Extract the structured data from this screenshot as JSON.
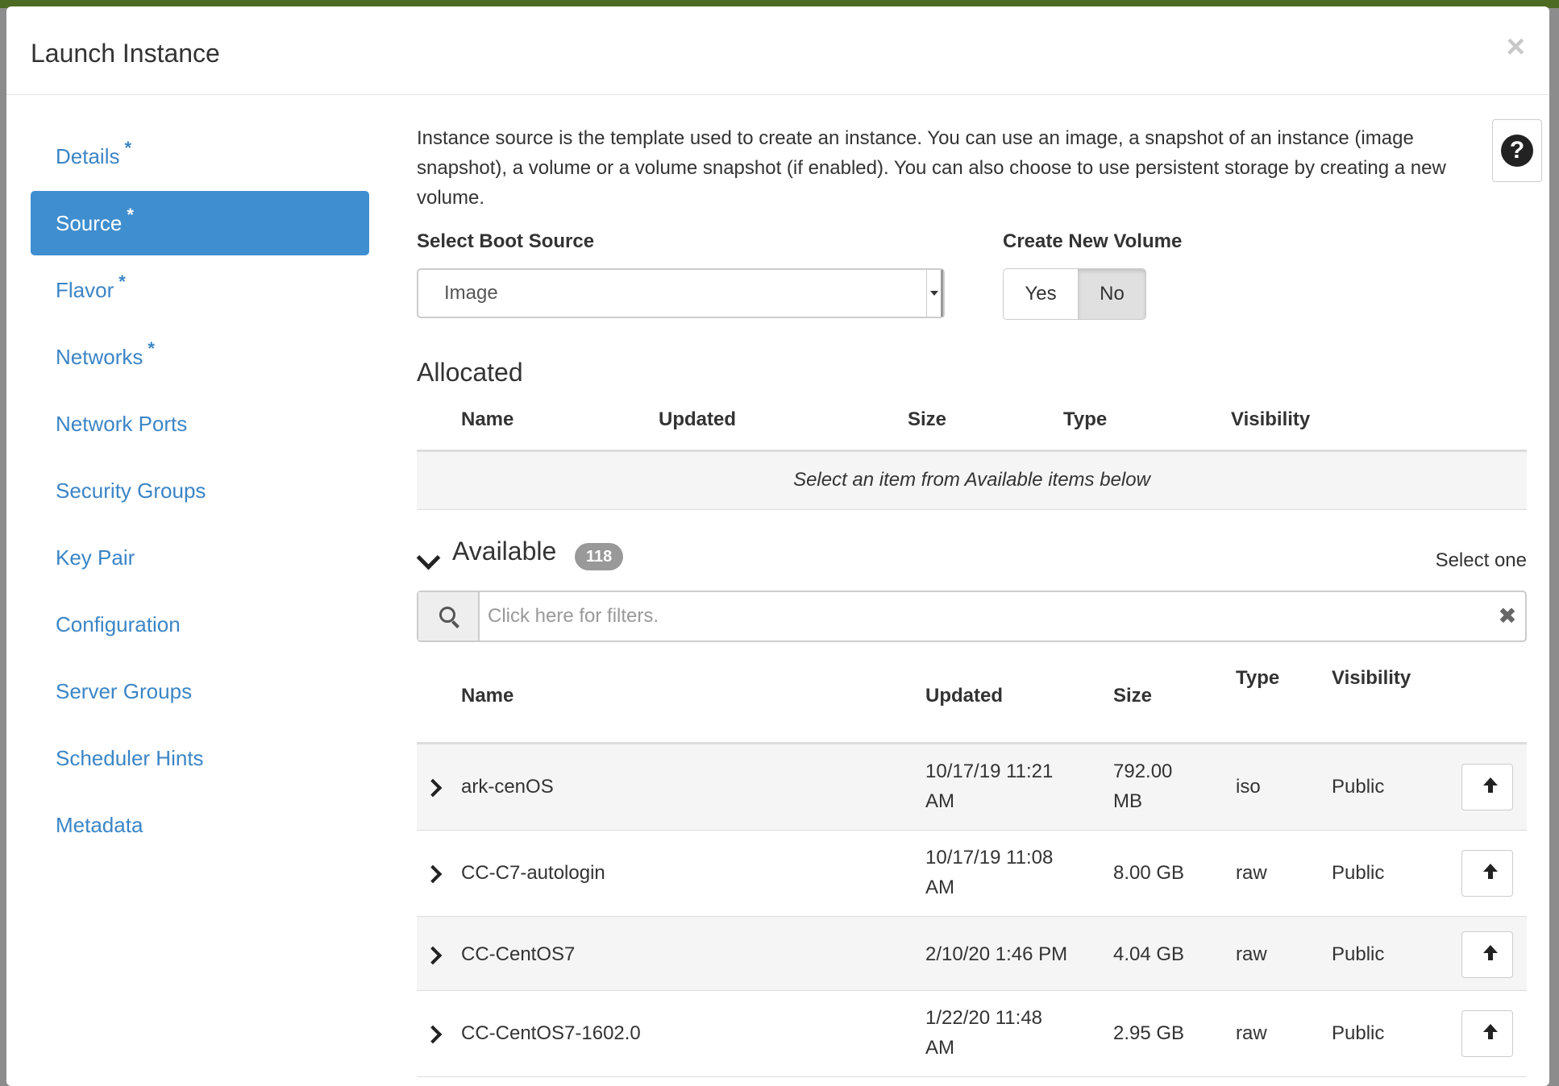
{
  "modal": {
    "title": "Launch Instance",
    "close": "×"
  },
  "sidebar": {
    "items": [
      {
        "label": "Details",
        "required": "*"
      },
      {
        "label": "Source",
        "required": "*",
        "active": true
      },
      {
        "label": "Flavor",
        "required": "*"
      },
      {
        "label": "Networks",
        "required": "*"
      },
      {
        "label": "Network Ports"
      },
      {
        "label": "Security Groups"
      },
      {
        "label": "Key Pair"
      },
      {
        "label": "Configuration"
      },
      {
        "label": "Server Groups"
      },
      {
        "label": "Scheduler Hints"
      },
      {
        "label": "Metadata"
      }
    ]
  },
  "source": {
    "description": "Instance source is the template used to create an instance. You can use an image, a snapshot of an instance (image snapshot), a volume or a volume snapshot (if enabled). You can also choose to use persistent storage by creating a new volume.",
    "help_icon": "?",
    "boot_source_label": "Select Boot Source",
    "boot_source_value": "Image",
    "new_volume_label": "Create New Volume",
    "yes_label": "Yes",
    "no_label": "No",
    "new_volume_selected": "No"
  },
  "allocated": {
    "title": "Allocated",
    "columns": [
      "Name",
      "Updated",
      "Size",
      "Type",
      "Visibility"
    ],
    "empty_message": "Select an item from Available items below"
  },
  "available": {
    "title": "Available",
    "count": "118",
    "select_hint": "Select one",
    "filter_placeholder": "Click here for filters.",
    "filter_clear": "✖",
    "columns": [
      "Name",
      "Updated",
      "Size",
      "Type",
      "Visibility"
    ],
    "rows": [
      {
        "name": "ark-cenOS",
        "updated_1": "10/17/19 11:21",
        "updated_2": "AM",
        "size_1": "792.00",
        "size_2": "MB",
        "type": "iso",
        "visibility": "Public"
      },
      {
        "name": "CC-C7-autologin",
        "updated_1": "10/17/19 11:08",
        "updated_2": "AM",
        "size_1": "8.00 GB",
        "size_2": "",
        "type": "raw",
        "visibility": "Public"
      },
      {
        "name": "CC-CentOS7",
        "updated_1": "2/10/20 1:46 PM",
        "updated_2": "",
        "size_1": "4.04 GB",
        "size_2": "",
        "type": "raw",
        "visibility": "Public"
      },
      {
        "name": "CC-CentOS7-1602.0",
        "updated_1": "1/22/20 11:48",
        "updated_2": "AM",
        "size_1": "2.95 GB",
        "size_2": "",
        "type": "raw",
        "visibility": "Public"
      }
    ]
  }
}
